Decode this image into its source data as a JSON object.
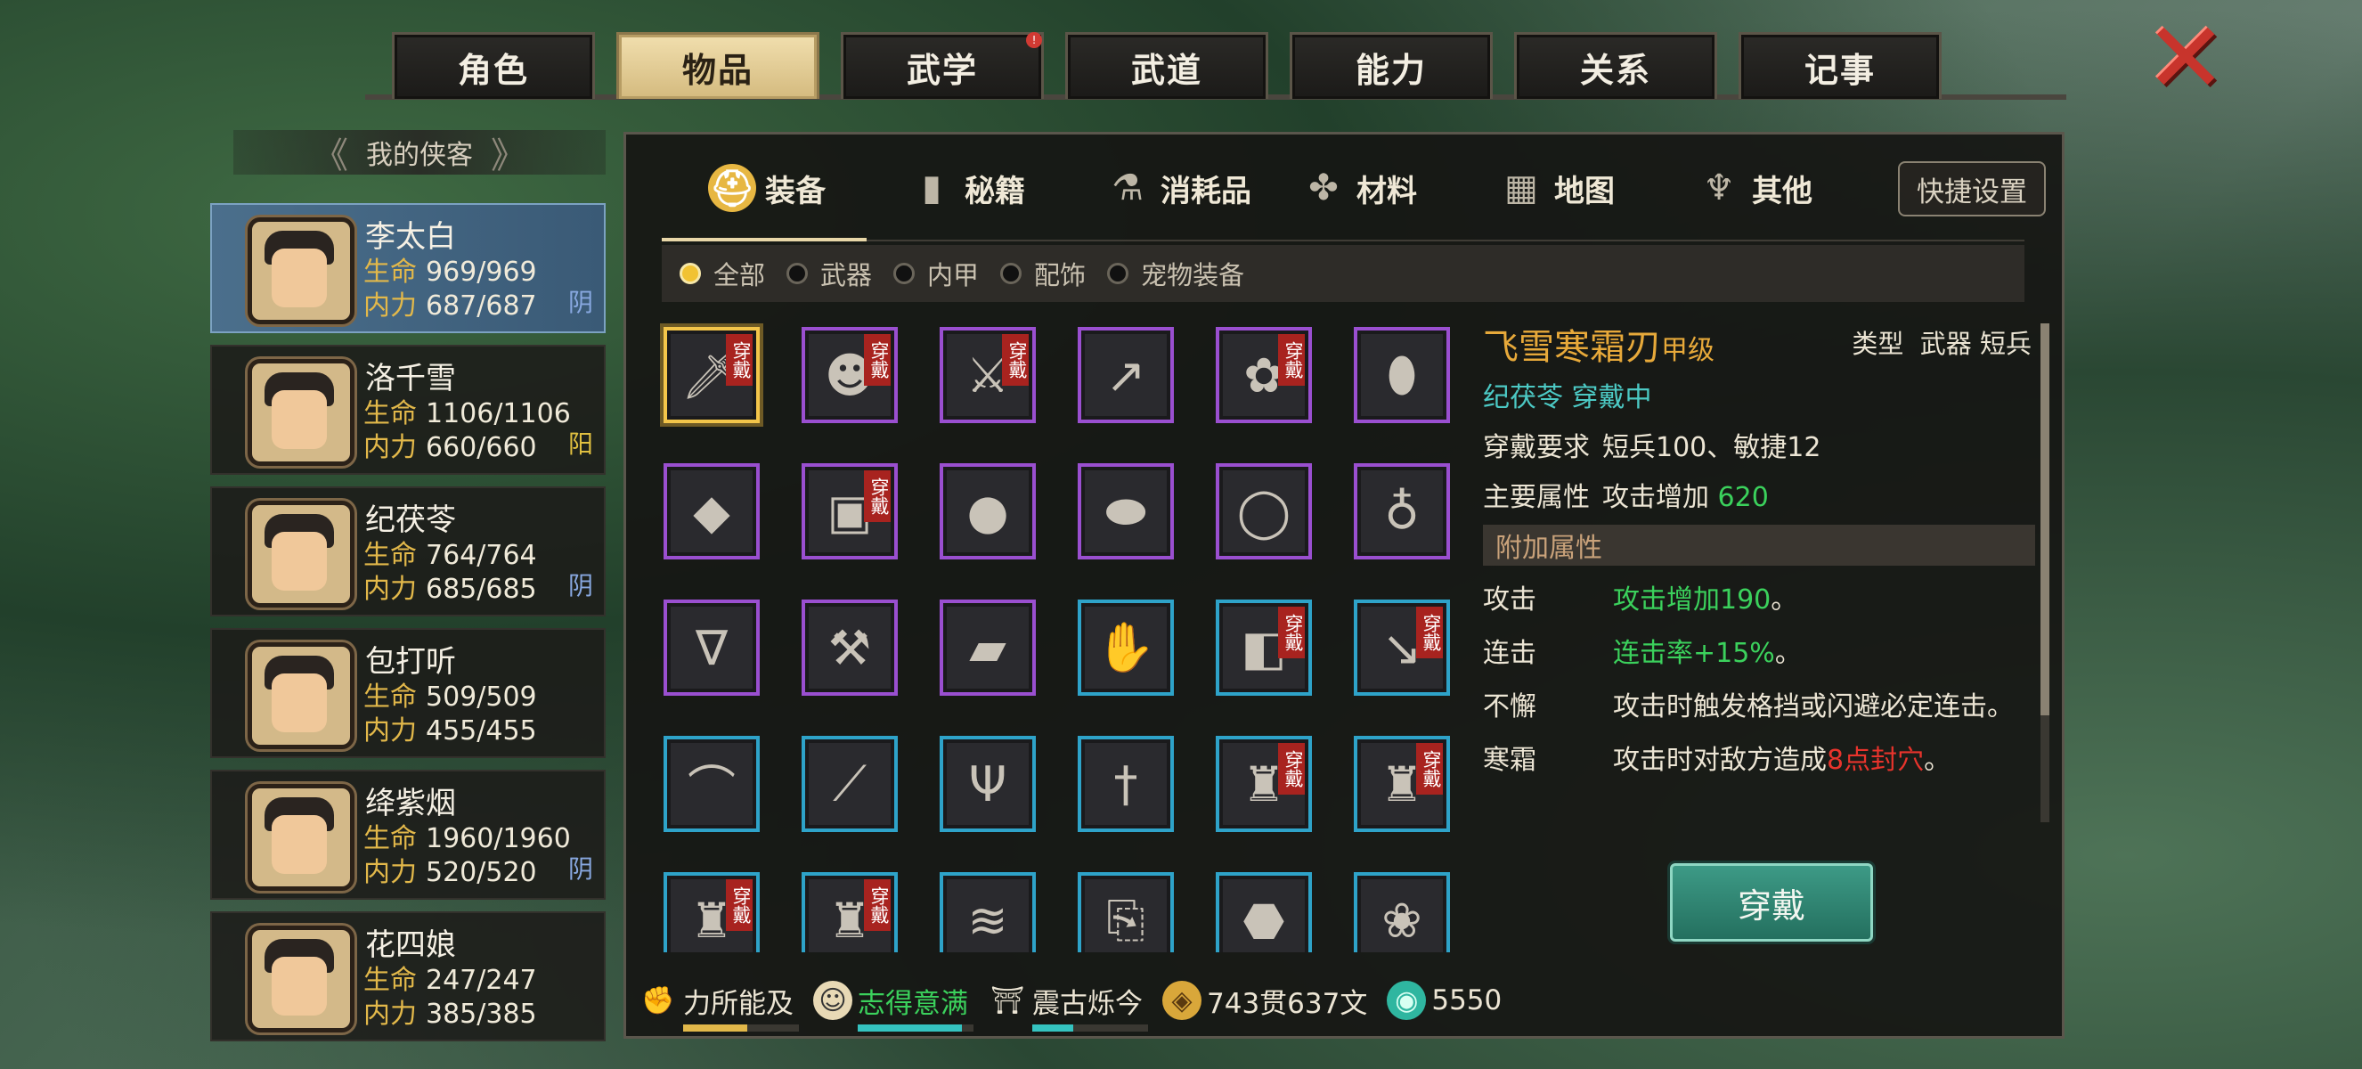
{
  "top_tabs": [
    {
      "label": "角色",
      "active": false
    },
    {
      "label": "物品",
      "active": true
    },
    {
      "label": "武学",
      "active": false,
      "badge": "!"
    },
    {
      "label": "武道",
      "active": false
    },
    {
      "label": "能力",
      "active": false
    },
    {
      "label": "关系",
      "active": false
    },
    {
      "label": "记事",
      "active": false
    }
  ],
  "left": {
    "header": "我的侠客",
    "heroes": [
      {
        "name": "李太白",
        "hp_label": "生命",
        "hp": "969/969",
        "mp_label": "内力",
        "mp": "687/687",
        "alignment": "阴",
        "active": true
      },
      {
        "name": "洛千雪",
        "hp_label": "生命",
        "hp": "1106/1106",
        "mp_label": "内力",
        "mp": "660/660",
        "alignment": "阳",
        "active": false
      },
      {
        "name": "纪茯苓",
        "hp_label": "生命",
        "hp": "764/764",
        "mp_label": "内力",
        "mp": "685/685",
        "alignment": "阴",
        "active": false
      },
      {
        "name": "包打听",
        "hp_label": "生命",
        "hp": "509/509",
        "mp_label": "内力",
        "mp": "455/455",
        "alignment": "",
        "active": false
      },
      {
        "name": "绛紫烟",
        "hp_label": "生命",
        "hp": "1960/1960",
        "mp_label": "内力",
        "mp": "520/520",
        "alignment": "阴",
        "active": false
      },
      {
        "name": "花四娘",
        "hp_label": "生命",
        "hp": "247/247",
        "mp_label": "内力",
        "mp": "385/385",
        "alignment": "",
        "active": false
      }
    ]
  },
  "categories": [
    {
      "label": "装备",
      "icon": "equipment-icon",
      "active": true
    },
    {
      "label": "秘籍",
      "icon": "book-icon",
      "active": false
    },
    {
      "label": "消耗品",
      "icon": "potion-icon",
      "active": false
    },
    {
      "label": "材料",
      "icon": "herb-icon",
      "active": false
    },
    {
      "label": "地图",
      "icon": "map-icon",
      "active": false
    },
    {
      "label": "其他",
      "icon": "other-icon",
      "active": false
    }
  ],
  "quick_settings": "快捷设置",
  "filters": [
    {
      "label": "全部",
      "on": true
    },
    {
      "label": "武器",
      "on": false
    },
    {
      "label": "内甲",
      "on": false
    },
    {
      "label": "配饰",
      "on": false
    },
    {
      "label": "宠物装备",
      "on": false
    }
  ],
  "worn_tag": "穿戴",
  "items": [
    {
      "icon": "sword-icon",
      "rarity": "gold",
      "worn": true
    },
    {
      "icon": "mask-icon",
      "rarity": "purple",
      "worn": true
    },
    {
      "icon": "broadsword-icon",
      "rarity": "purple",
      "worn": true
    },
    {
      "icon": "spear-icon",
      "rarity": "purple",
      "worn": false
    },
    {
      "icon": "flower-icon",
      "rarity": "purple",
      "worn": true
    },
    {
      "icon": "gourd-icon",
      "rarity": "purple",
      "worn": false
    },
    {
      "icon": "gold-nugget-icon",
      "rarity": "purple",
      "worn": false
    },
    {
      "icon": "armor-icon",
      "rarity": "purple",
      "worn": true
    },
    {
      "icon": "pouch-icon",
      "rarity": "purple",
      "worn": false
    },
    {
      "icon": "shield-icon",
      "rarity": "purple",
      "worn": false
    },
    {
      "icon": "pearl-icon",
      "rarity": "purple",
      "worn": false
    },
    {
      "icon": "bottle-icon",
      "rarity": "purple",
      "worn": false
    },
    {
      "icon": "amulet-icon",
      "rarity": "purple",
      "worn": false
    },
    {
      "icon": "axe-icon",
      "rarity": "purple",
      "worn": false
    },
    {
      "icon": "tag-icon",
      "rarity": "purple",
      "worn": false
    },
    {
      "icon": "gauntlet-icon",
      "rarity": "blue",
      "worn": false
    },
    {
      "icon": "bracer-icon",
      "rarity": "blue",
      "worn": true
    },
    {
      "icon": "dagger-icon",
      "rarity": "blue",
      "worn": true
    },
    {
      "icon": "saber-icon",
      "rarity": "blue",
      "worn": false
    },
    {
      "icon": "serrated-blade-icon",
      "rarity": "blue",
      "worn": false
    },
    {
      "icon": "trident-icon",
      "rarity": "blue",
      "worn": false
    },
    {
      "icon": "knife-icon",
      "rarity": "blue",
      "worn": false
    },
    {
      "icon": "red-robe-icon",
      "rarity": "blue",
      "worn": true
    },
    {
      "icon": "red-coat-icon",
      "rarity": "blue",
      "worn": true
    },
    {
      "icon": "vest-icon",
      "rarity": "blue",
      "worn": true
    },
    {
      "icon": "blue-robe-icon",
      "rarity": "blue",
      "worn": true
    },
    {
      "icon": "claw-icon",
      "rarity": "blue",
      "worn": false
    },
    {
      "icon": "scroll-icon",
      "rarity": "blue",
      "worn": false
    },
    {
      "icon": "stone-icon",
      "rarity": "blue",
      "worn": false
    },
    {
      "icon": "peony-icon",
      "rarity": "blue",
      "worn": false
    }
  ],
  "detail": {
    "name": "飞雪寒霜刃",
    "grade": "甲级",
    "type_label": "类型",
    "type_value": "武器 短兵",
    "owner": "纪茯苓 穿戴中",
    "req_label": "穿戴要求",
    "req_value": "短兵100、敏捷12",
    "main_label": "主要属性",
    "main_prefix": "攻击增加",
    "main_value": "620",
    "extra_header": "附加属性",
    "attrs": [
      {
        "key": "攻击",
        "value": "攻击增加190",
        "suffix": "。"
      },
      {
        "key": "连击",
        "value": "连击率+15%",
        "suffix": "。"
      },
      {
        "key": "不懈",
        "value": "攻击时触发格挡或闪避必定连击。"
      },
      {
        "key": "寒霜",
        "prefix": "攻击时对敌方造成",
        "value": "8点封穴",
        "suffix": "。"
      }
    ],
    "wear_button": "穿戴"
  },
  "status": [
    {
      "label": "力所能及",
      "icon": "strength-icon",
      "color": "#ece5d4",
      "bar": 0.55,
      "bar_color": "#e2b84a"
    },
    {
      "label": "志得意满",
      "icon": "smile-icon",
      "color": "#3bd15c",
      "bar": 0.9,
      "bar_color": "#35c3c0"
    },
    {
      "label": "震古烁今",
      "icon": "fame-icon",
      "color": "#ece5d4",
      "bar": 0.35,
      "bar_color": "#35c3c0"
    }
  ],
  "money": "743贯637文",
  "gems": "5550",
  "colors": {
    "gold": "#e7a93a",
    "teal": "#4cc9c4",
    "green": "#3bd15c",
    "red": "#e8342c",
    "purple_frame": "#9a4fd0",
    "blue_frame": "#2ea3c9"
  }
}
